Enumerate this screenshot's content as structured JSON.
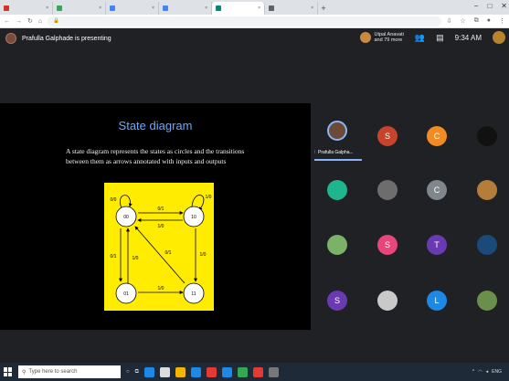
{
  "browser": {
    "tabs": [
      {
        "title": "",
        "color": "#d93025"
      },
      {
        "title": "",
        "color": "#34a853"
      },
      {
        "title": "",
        "color": "#4285f4"
      },
      {
        "title": "",
        "color": "#4285f4"
      },
      {
        "title": "",
        "color": "#00897b",
        "active": true
      },
      {
        "title": "",
        "color": "#5f6368"
      }
    ],
    "new_tab": "+",
    "url": "",
    "url_host": "",
    "controls": {
      "minimize": "−",
      "maximize": "□",
      "close": "✕"
    }
  },
  "meet": {
    "presenter_label": "Prafulla Galphade is presenting",
    "others_line1": "Utpal Anavati",
    "others_line2": "and 79 more",
    "people_count": "",
    "time": "9:34 AM",
    "self_label": ""
  },
  "slide": {
    "title": "State diagram",
    "body": "A state diagram represents the states as circles and the transitions between them as arrows annotated with inputs and outputs",
    "diagram": {
      "background": "#ffec00",
      "states": [
        "00",
        "10",
        "01",
        "11"
      ],
      "labels": {
        "loop_00": "0/0",
        "loop_10": "1/0",
        "e_00_10": "0/1",
        "e_10_00": "1/0",
        "e_10_11": "1/0",
        "e_11_10": "0/1",
        "e_01_00": "1/0",
        "e_00_01": "0/1",
        "e_01_11": "1/0",
        "e_11_00": "0/1",
        "loop_01": "",
        "loop_11": ""
      }
    }
  },
  "gallery": {
    "speaker_name": "Prafulla Galpha...",
    "tiles": [
      {
        "letter": "S",
        "color": "#c5442b"
      },
      {
        "letter": "C",
        "color": "#f28b22"
      },
      {
        "letter": "",
        "color": "#111111"
      },
      {
        "letter": "",
        "color": "#1fb58f"
      },
      {
        "letter": "",
        "color": "#6d6d6d"
      },
      {
        "letter": "C",
        "color": "#80868b"
      },
      {
        "letter": "",
        "color": "#b47d3a"
      },
      {
        "letter": "",
        "color": "#7bb267"
      },
      {
        "letter": "S",
        "color": "#e8457a"
      },
      {
        "letter": "T",
        "color": "#6a3ab2"
      },
      {
        "letter": "",
        "color": "#1a4a7a"
      },
      {
        "letter": "S",
        "color": "#6a3ab2"
      },
      {
        "letter": "",
        "color": "#c9c9c9"
      },
      {
        "letter": "L",
        "color": "#1e88e5"
      },
      {
        "letter": "",
        "color": "#6a8f4a"
      }
    ]
  },
  "taskbar": {
    "search_placeholder": "Type here to search",
    "time": "",
    "date": "",
    "lang": "ENG"
  }
}
